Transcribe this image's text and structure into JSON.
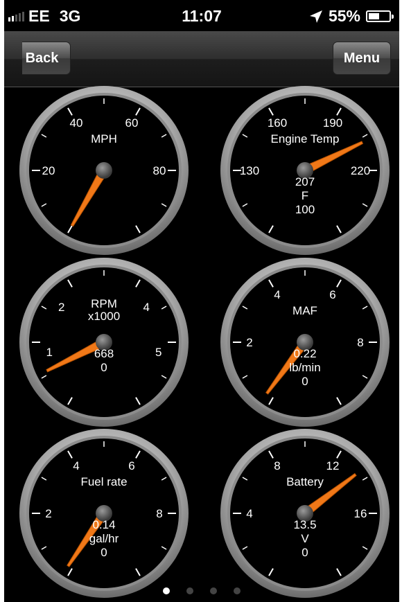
{
  "status_bar": {
    "carrier": "EE",
    "network": "3G",
    "time": "11:07",
    "battery_percent": "55%",
    "battery_level": 0.55
  },
  "nav": {
    "back_label": "Back",
    "menu_label": "Menu"
  },
  "gauges": [
    {
      "id": "mph",
      "title": "MPH",
      "title2": "",
      "value_text": "",
      "unit": "",
      "min_label": "",
      "ticks": [
        "20",
        "40",
        "60",
        "80"
      ],
      "needle_value": 0,
      "needle_color": "#f07818"
    },
    {
      "id": "engine-temp",
      "title": "Engine Temp",
      "title2": "",
      "value_text": "207",
      "unit": "F",
      "min_label": "100",
      "ticks": [
        "130",
        "160",
        "190",
        "220"
      ],
      "needle_value": 207,
      "needle_color": "#f07818"
    },
    {
      "id": "rpm",
      "title": "RPM",
      "title2": "x1000",
      "value_text": "668",
      "unit": "",
      "min_label": "0",
      "ticks": [
        "1",
        "2",
        "4",
        "5"
      ],
      "needle_value": 0.668,
      "needle_color": "#f07818"
    },
    {
      "id": "maf",
      "title": "MAF",
      "title2": "",
      "value_text": "0.22",
      "unit": "lb/min",
      "min_label": "0",
      "ticks": [
        "2",
        "4",
        "6",
        "8"
      ],
      "needle_value": 0.22,
      "needle_color": "#f07818"
    },
    {
      "id": "fuel-rate",
      "title": "Fuel rate",
      "title2": "",
      "value_text": "0.14",
      "unit": "gal/hr",
      "min_label": "0",
      "ticks": [
        "2",
        "4",
        "6",
        "8"
      ],
      "needle_value": 0.14,
      "needle_color": "#f07818"
    },
    {
      "id": "battery",
      "title": "Battery",
      "title2": "",
      "value_text": "13.5",
      "unit": "V",
      "min_label": "0",
      "ticks": [
        "4",
        "8",
        "12",
        "16"
      ],
      "needle_value": 13.5,
      "needle_color": "#f07818"
    }
  ],
  "pager": {
    "pages": 4,
    "current": 1
  }
}
